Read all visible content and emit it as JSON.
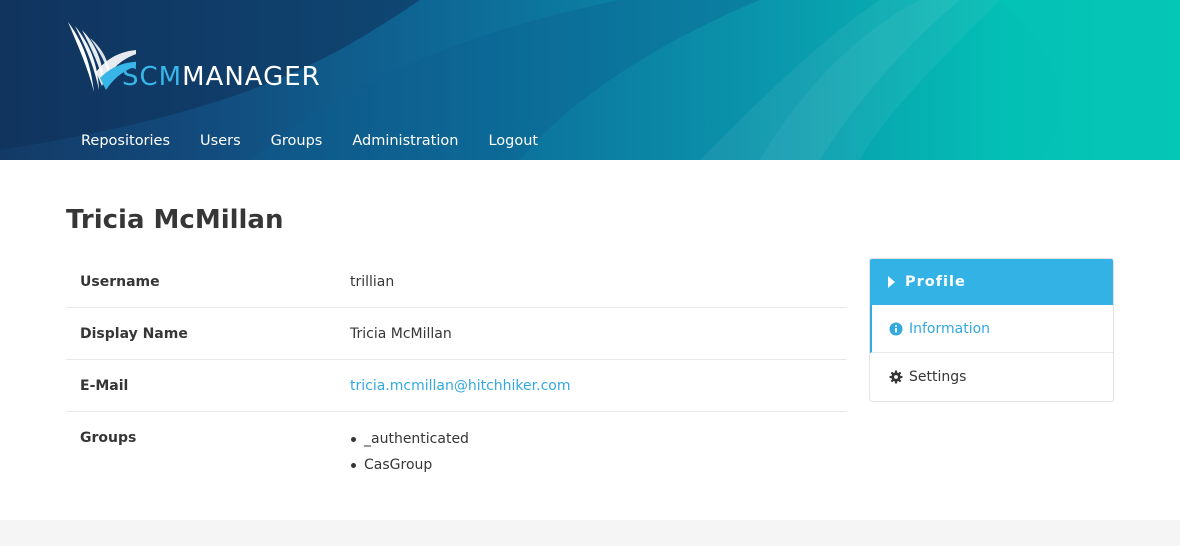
{
  "brand": {
    "logo_scm": "SCM",
    "logo_manager": "MANAGER",
    "primary_color": "#33b2e5",
    "link_color": "#33a9df"
  },
  "nav": {
    "items": [
      {
        "label": "Repositories"
      },
      {
        "label": "Users"
      },
      {
        "label": "Groups"
      },
      {
        "label": "Administration"
      },
      {
        "label": "Logout"
      }
    ]
  },
  "user": {
    "title": "Tricia McMillan",
    "fields": {
      "username": {
        "label": "Username",
        "value": "trillian"
      },
      "display_name": {
        "label": "Display Name",
        "value": "Tricia McMillan"
      },
      "email": {
        "label": "E-Mail",
        "value": "tricia.mcmillan@hitchhiker.com"
      },
      "groups": {
        "label": "Groups",
        "values": [
          "_authenticated",
          "CasGroup"
        ]
      }
    }
  },
  "side_menu": {
    "header": "Profile",
    "items": [
      {
        "label": "Information",
        "icon": "info-circle-icon",
        "active": true
      },
      {
        "label": "Settings",
        "icon": "gear-icon",
        "active": false
      }
    ]
  }
}
